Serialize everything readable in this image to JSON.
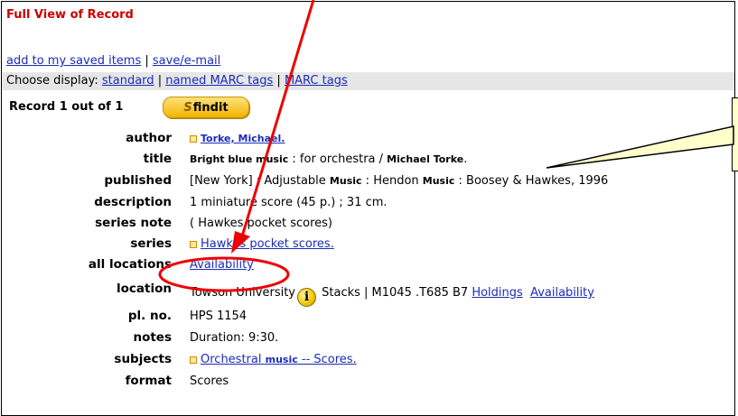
{
  "header": {
    "title": "Full View of Record"
  },
  "actions": {
    "save_items": "add to my saved items",
    "separator": "|",
    "save_email": "save/e-mail"
  },
  "display": {
    "label": "Choose display:",
    "options": [
      "standard",
      "named MARC tags",
      "MARC tags"
    ],
    "separator": "|"
  },
  "record": {
    "position_text": "Record 1 out of 1",
    "findit_label": "findit"
  },
  "fields": {
    "author": {
      "label": "author",
      "value": "Torke, Michael."
    },
    "title": {
      "label": "title",
      "value_a": "Bright blue music",
      "value_b": " : for orchestra / ",
      "value_c": "Michael Torke",
      "value_d": "."
    },
    "published": {
      "label": "published",
      "value_a": "[New York] : Adjustable ",
      "music1": "Music",
      "value_b": " : Hendon ",
      "music2": "Music",
      "value_c": " : Boosey & Hawkes, 1996"
    },
    "description": {
      "label": "description",
      "value": "1 miniature score (45 p.) ; 31 cm."
    },
    "series_note": {
      "label": "series note",
      "value": "( Hawkes pocket scores)"
    },
    "series": {
      "label": "series",
      "value": "Hawkes pocket scores."
    },
    "all_locations": {
      "label": "all locations",
      "value": "Availability"
    },
    "location": {
      "label": "location",
      "value_a": "Towson University",
      "value_b": " Stacks | M1045 .T685 B7 ",
      "holdings": "Holdings",
      "availability": "Availability"
    },
    "pl_no": {
      "label": "pl. no.",
      "value": "HPS 1154"
    },
    "notes": {
      "label": "notes",
      "value": "Duration: 9:30."
    },
    "subjects": {
      "label": "subjects",
      "value_a": "Orchestral ",
      "music": "music",
      "value_b": " -- Scores."
    },
    "format": {
      "label": "format",
      "value": "Scores"
    }
  },
  "colors": {
    "header_red": "#cc0000",
    "link_blue": "#1a2bb8",
    "annotation_red": "#ee0000",
    "display_bar": "#e6e6e6",
    "bubble": "#ffffcc"
  }
}
